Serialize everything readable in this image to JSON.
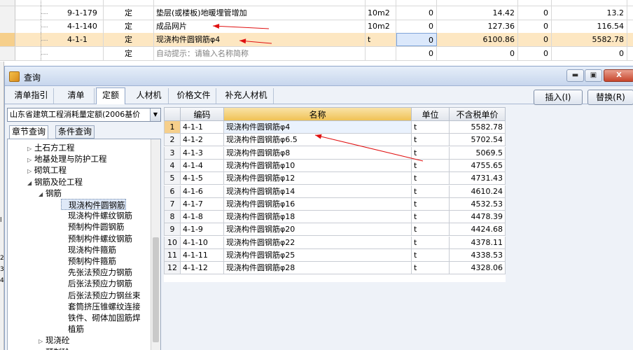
{
  "background_grid": {
    "rows": [
      {
        "code": "",
        "type": "",
        "name": "",
        "unit": "",
        "qty": "",
        "price": "",
        "c7": "",
        "total": ""
      },
      {
        "code": "9-1-179",
        "type": "定",
        "name": "垫层(或楼板)地暖埋管增加",
        "unit": "10m2",
        "qty": "0",
        "price": "14.42",
        "c7": "0",
        "total": "13.2"
      },
      {
        "code": "4-1-140",
        "type": "定",
        "name": "成品网片",
        "unit": "10m2",
        "qty": "0",
        "price": "127.36",
        "c7": "0",
        "total": "116.54"
      },
      {
        "code": "4-1-1",
        "type": "定",
        "name": "现浇构件圆钢筋φ4",
        "unit": "t",
        "qty": "0",
        "price": "6100.86",
        "c7": "0",
        "total": "5582.78"
      },
      {
        "code": "",
        "type": "定",
        "name": "自动提示：请输入名称简称",
        "unit": "",
        "qty": "0",
        "price": "0",
        "c7": "0",
        "total": "0"
      }
    ]
  },
  "window": {
    "title": "查询",
    "min_label": "▬",
    "max_label": "▣",
    "close_label": "X"
  },
  "tabs": [
    {
      "label": "清单指引"
    },
    {
      "label": "清单"
    },
    {
      "label": "定额"
    },
    {
      "label": "人材机"
    },
    {
      "label": "价格文件"
    },
    {
      "label": "补充人材机"
    }
  ],
  "actions": {
    "insert_label": "插入(I)",
    "replace_label": "替换(R)"
  },
  "left": {
    "quota_select": "山东省建筑工程消耗量定额(2006基价",
    "sub_tabs": [
      "章节查询",
      "条件查询"
    ],
    "tree": [
      {
        "label": "土石方工程",
        "state": "▷"
      },
      {
        "label": "地基处理与防护工程",
        "state": "▷"
      },
      {
        "label": "砌筑工程",
        "state": "▷"
      },
      {
        "label": "钢筋及砼工程",
        "state": "◢"
      },
      {
        "label": "钢筋",
        "state": "◢"
      },
      {
        "label": "现浇构件圆钢筋",
        "state": ""
      },
      {
        "label": "现浇构件螺纹钢筋",
        "state": ""
      },
      {
        "label": "预制构件圆钢筋",
        "state": ""
      },
      {
        "label": "预制构件螺纹钢筋",
        "state": ""
      },
      {
        "label": "现浇构件箍筋",
        "state": ""
      },
      {
        "label": "预制构件箍筋",
        "state": ""
      },
      {
        "label": "先张法预应力钢筋",
        "state": ""
      },
      {
        "label": "后张法预应力钢筋",
        "state": ""
      },
      {
        "label": "后张法预应力钢丝束",
        "state": ""
      },
      {
        "label": "套筒挤压锥螺纹连接",
        "state": ""
      },
      {
        "label": "铁件、砌体加固筋焊",
        "state": ""
      },
      {
        "label": "植筋",
        "state": ""
      },
      {
        "label": "现浇砼",
        "state": "▷"
      },
      {
        "label": "预制砼",
        "state": "▷"
      }
    ]
  },
  "grid": {
    "headers": {
      "code": "编码",
      "name": "名称",
      "unit": "单位",
      "price": "不含税单价"
    },
    "rows": [
      {
        "no": "1",
        "code": "4-1-1",
        "name": "现浇构件圆钢筋φ4",
        "unit": "t",
        "price": "5582.78"
      },
      {
        "no": "2",
        "code": "4-1-2",
        "name": "现浇构件圆钢筋φ6.5",
        "unit": "t",
        "price": "5702.54"
      },
      {
        "no": "3",
        "code": "4-1-3",
        "name": "现浇构件圆钢筋φ8",
        "unit": "t",
        "price": "5069.5"
      },
      {
        "no": "4",
        "code": "4-1-4",
        "name": "现浇构件圆钢筋φ10",
        "unit": "t",
        "price": "4755.65"
      },
      {
        "no": "5",
        "code": "4-1-5",
        "name": "现浇构件圆钢筋φ12",
        "unit": "t",
        "price": "4731.43"
      },
      {
        "no": "6",
        "code": "4-1-6",
        "name": "现浇构件圆钢筋φ14",
        "unit": "t",
        "price": "4610.24"
      },
      {
        "no": "7",
        "code": "4-1-7",
        "name": "现浇构件圆钢筋φ16",
        "unit": "t",
        "price": "4532.53"
      },
      {
        "no": "8",
        "code": "4-1-8",
        "name": "现浇构件圆钢筋φ18",
        "unit": "t",
        "price": "4478.39"
      },
      {
        "no": "9",
        "code": "4-1-9",
        "name": "现浇构件圆钢筋φ20",
        "unit": "t",
        "price": "4424.68"
      },
      {
        "no": "10",
        "code": "4-1-10",
        "name": "现浇构件圆钢筋φ22",
        "unit": "t",
        "price": "4378.11"
      },
      {
        "no": "11",
        "code": "4-1-11",
        "name": "现浇构件圆钢筋φ25",
        "unit": "t",
        "price": "4338.53"
      },
      {
        "no": "12",
        "code": "4-1-12",
        "name": "现浇构件圆钢筋φ28",
        "unit": "t",
        "price": "4328.06"
      }
    ]
  },
  "edge_marks": [
    "l",
    "2",
    "3",
    "4"
  ],
  "annotation_color": "#e01010"
}
